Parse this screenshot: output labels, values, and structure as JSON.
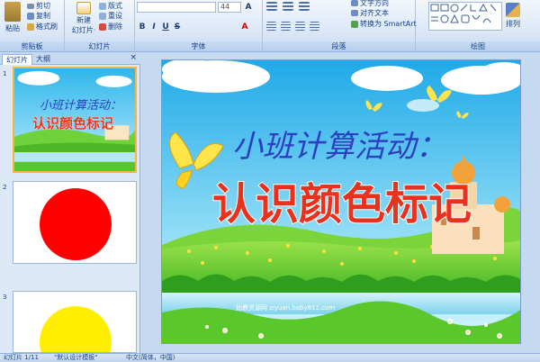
{
  "ribbon": {
    "clipboard": {
      "paste": "粘贴",
      "cut": "剪切",
      "copy": "复制",
      "format_painter": "格式刷",
      "label": "剪贴板"
    },
    "slides": {
      "new_slide": "新建",
      "new_slide2": "幻灯片·",
      "layout": "版式",
      "reset": "重设",
      "delete": "删除",
      "label": "幻灯片"
    },
    "font": {
      "size": "44",
      "label": "字体"
    },
    "paragraph": {
      "text_direction": "文字方向",
      "align_text": "对齐文本",
      "smartart": "转换为 SmartArt",
      "label": "段落"
    },
    "drawing": {
      "arrange": "排列",
      "label": "绘图"
    }
  },
  "panel": {
    "tab_slides": "幻灯片",
    "tab_outline": "大纲",
    "close": "×",
    "thumbs": [
      {
        "num": "1",
        "title1": "小班计算活动：",
        "title2": "认识颜色标记"
      },
      {
        "num": "2",
        "circle": "#ff0000"
      },
      {
        "num": "3",
        "circle": "#ffee00"
      }
    ]
  },
  "slide": {
    "title1": "小班计算活动：",
    "title2": "认识颜色标记",
    "watermark": "幼教资源网 ziyuan.baby611.com"
  },
  "status": {
    "slide_count": "幻灯片 1/11",
    "theme": "\"默认设计模板\"",
    "lang": "中文(简体，中国)"
  }
}
